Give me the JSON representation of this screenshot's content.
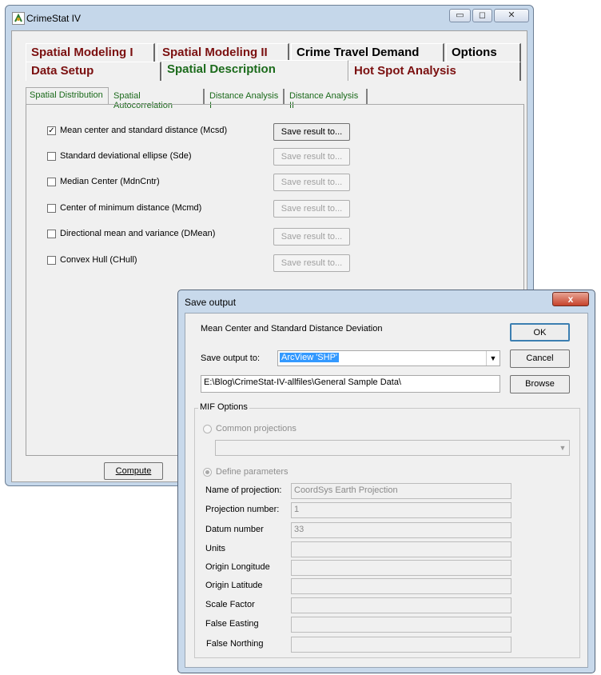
{
  "main_window": {
    "title": "CrimeStat IV",
    "caption": {
      "minimize": "▭",
      "maximize": "◻",
      "close": "✕"
    },
    "tabs_row1": [
      "Spatial Modeling I",
      "Spatial Modeling II",
      "Crime Travel Demand",
      "Options"
    ],
    "tabs_row2": [
      "Data Setup",
      "Spatial Description",
      "Hot Spot Analysis"
    ],
    "subtabs": [
      "Spatial Distribution",
      "Spatial Autocorrelation",
      "Distance Analysis I",
      "Distance Analysis II"
    ],
    "options": [
      {
        "label": "Mean center and standard distance (Mcsd)",
        "checked": true,
        "button": "Save result to..."
      },
      {
        "label": "Standard deviational ellipse (Sde)",
        "checked": false,
        "button": "Save result to..."
      },
      {
        "label": "Median Center (MdnCntr)",
        "checked": false,
        "button": "Save result to..."
      },
      {
        "label": "Center of minimum distance (Mcmd)",
        "checked": false,
        "button": "Save result to..."
      },
      {
        "label": "Directional mean and variance (DMean)",
        "checked": false,
        "button": "Save result to..."
      },
      {
        "label": "Convex Hull (CHull)",
        "checked": false,
        "button": "Save result to..."
      }
    ],
    "compute_label": "Compute"
  },
  "dialog": {
    "title": "Save output",
    "close": "x",
    "heading": "Mean Center and Standard Distance Deviation",
    "ok_label": "OK",
    "cancel_label": "Cancel",
    "browse_label": "Browse",
    "save_to_label": "Save output to:",
    "save_to_value": "ArcView 'SHP'",
    "path_value": "E:\\Blog\\CrimeStat-IV-allfiles\\General Sample Data\\",
    "mif_group": "MIF Options",
    "common_projections": "Common projections",
    "define_parameters": "Define parameters",
    "params": [
      {
        "label": "Name of projection:",
        "value": "CoordSys Earth Projection"
      },
      {
        "label": "Projection number:",
        "value": "1"
      },
      {
        "label": "Datum number",
        "value": "33"
      },
      {
        "label": "Units",
        "value": ""
      },
      {
        "label": "Origin Longitude",
        "value": ""
      },
      {
        "label": "Origin Latitude",
        "value": ""
      },
      {
        "label": "Scale Factor",
        "value": ""
      },
      {
        "label": "False Easting",
        "value": ""
      },
      {
        "label": "False Northing",
        "value": ""
      }
    ]
  }
}
